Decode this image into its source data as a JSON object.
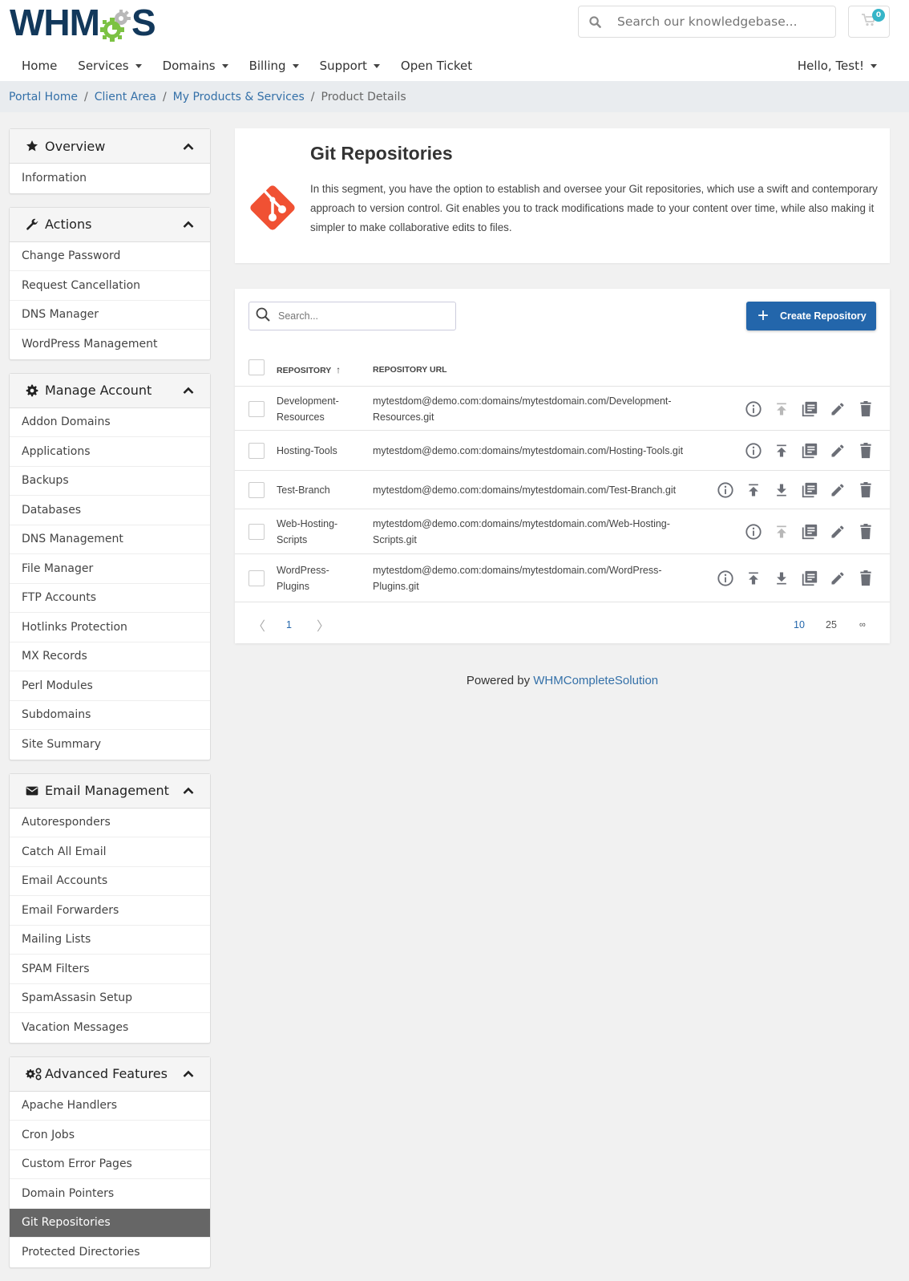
{
  "header": {
    "logo_text_left": "WHM",
    "logo_text_right": "S",
    "search_placeholder": "Search our knowledgebase...",
    "cart_count": "0",
    "nav": [
      {
        "label": "Home",
        "dropdown": false
      },
      {
        "label": "Services",
        "dropdown": true
      },
      {
        "label": "Domains",
        "dropdown": true
      },
      {
        "label": "Billing",
        "dropdown": true
      },
      {
        "label": "Support",
        "dropdown": true
      },
      {
        "label": "Open Ticket",
        "dropdown": false
      }
    ],
    "user_greeting": "Hello, Test!"
  },
  "breadcrumb": {
    "items": [
      "Portal Home",
      "Client Area",
      "My Products & Services"
    ],
    "current": "Product Details",
    "separator": "/"
  },
  "sidebar": {
    "panels": [
      {
        "title": "Overview",
        "icon": "star-icon",
        "items": [
          "Information"
        ]
      },
      {
        "title": "Actions",
        "icon": "wrench-icon",
        "items": [
          "Change Password",
          "Request Cancellation",
          "DNS Manager",
          "WordPress Management"
        ]
      },
      {
        "title": "Manage Account",
        "icon": "gear-icon",
        "items": [
          "Addon Domains",
          "Applications",
          "Backups",
          "Databases",
          "DNS Management",
          "File Manager",
          "FTP Accounts",
          "Hotlinks Protection",
          "MX Records",
          "Perl Modules",
          "Subdomains",
          "Site Summary"
        ]
      },
      {
        "title": "Email Management",
        "icon": "envelope-icon",
        "items": [
          "Autoresponders",
          "Catch All Email",
          "Email Accounts",
          "Email Forwarders",
          "Mailing Lists",
          "SPAM Filters",
          "SpamAssasin Setup",
          "Vacation Messages"
        ]
      },
      {
        "title": "Advanced Features",
        "icon": "gears-icon",
        "items": [
          "Apache Handlers",
          "Cron Jobs",
          "Custom Error Pages",
          "Domain Pointers",
          "Git Repositories",
          "Protected Directories"
        ],
        "active_item": "Git Repositories"
      }
    ]
  },
  "intro": {
    "title": "Git Repositories",
    "text": "In this segment, you have the option to establish and oversee your Git repositories, which use a swift and contemporary approach to version control. Git enables you to track modifications made to your content over time, while also making it simpler to make collaborative edits to files."
  },
  "table": {
    "search_placeholder": "Search...",
    "create_label": "Create Repository",
    "columns": {
      "repository": "REPOSITORY",
      "url": "REPOSITORY URL"
    },
    "sort_indicator": "↑",
    "rows": [
      {
        "name": "Development-Resources",
        "name_lines": [
          "Development-",
          "Resources"
        ],
        "url_lines": [
          "mytestdom@demo.com:domains/mytestdomain.com/Development-",
          "Resources.git"
        ],
        "push_enabled": false,
        "pull": false
      },
      {
        "name": "Hosting-Tools",
        "name_lines": [
          "Hosting-Tools"
        ],
        "url_lines": [
          "mytestdom@demo.com:domains/mytestdomain.com/Hosting-Tools.git"
        ],
        "push_enabled": true,
        "pull": false
      },
      {
        "name": "Test-Branch",
        "name_lines": [
          "Test-Branch"
        ],
        "url_lines": [
          "mytestdom@demo.com:domains/mytestdomain.com/Test-Branch.git"
        ],
        "push_enabled": true,
        "pull": true
      },
      {
        "name": "Web-Hosting-Scripts",
        "name_lines": [
          "Web-Hosting-",
          "Scripts"
        ],
        "url_lines": [
          "mytestdom@demo.com:domains/mytestdomain.com/Web-Hosting-",
          "Scripts.git"
        ],
        "push_enabled": false,
        "pull": false
      },
      {
        "name": "WordPress-Plugins",
        "name_lines": [
          "WordPress-",
          "Plugins"
        ],
        "url_lines": [
          "mytestdom@demo.com:domains/mytestdomain.com/WordPress-",
          "Plugins.git"
        ],
        "push_enabled": true,
        "pull": true
      }
    ],
    "pagination": {
      "prev": "〈",
      "current_page": "1",
      "next": "〉",
      "page_sizes": [
        "10",
        "25",
        "∞"
      ],
      "active_size": "10"
    }
  },
  "footer": {
    "prefix": "Powered by",
    "link": "WHMCompleteSolution"
  },
  "colors": {
    "brand_dark": "#12385b",
    "brand_green": "#7cc243",
    "accent_blue": "#2366ab",
    "link": "#3470a8",
    "git_orange": "#f05133",
    "active_sidebar": "#666666",
    "icon_gray": "#6b6e76",
    "icon_disabled": "#b8b8b8",
    "cart_badge": "#36b5c8"
  }
}
